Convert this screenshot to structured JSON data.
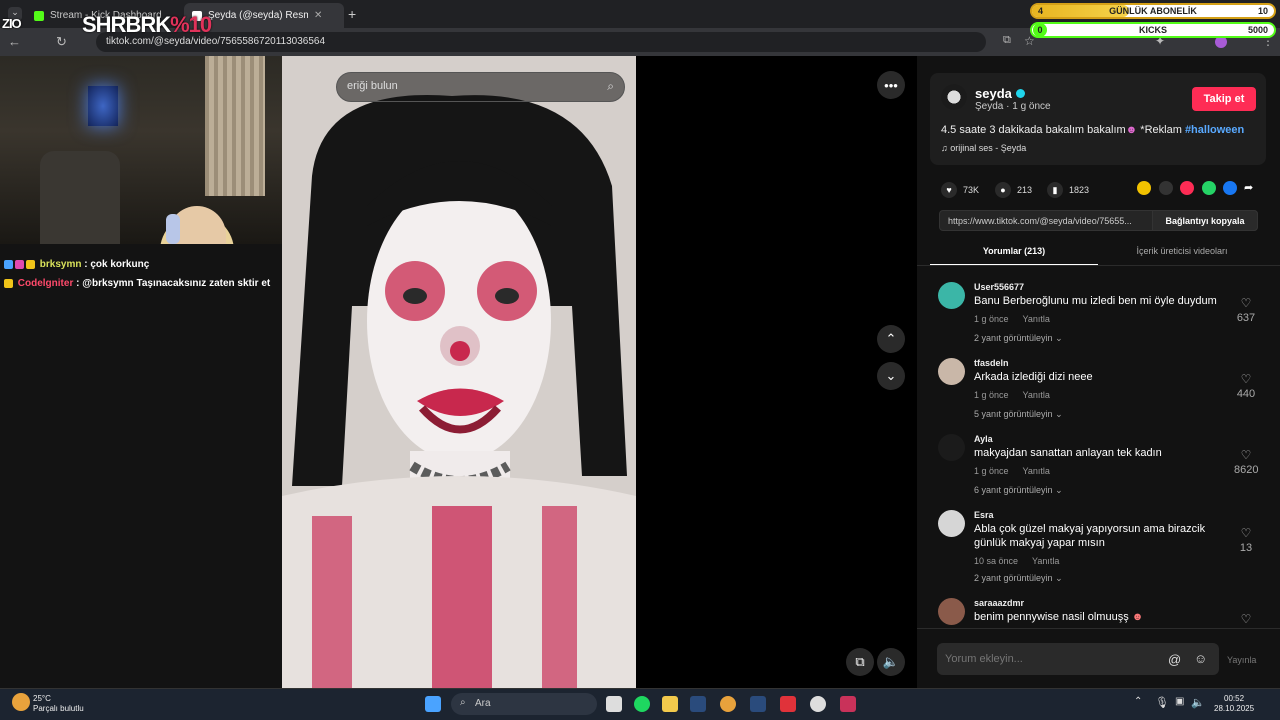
{
  "browser": {
    "tabs": [
      {
        "title": "Stream - Kick Dashboard",
        "active": false
      },
      {
        "title": "Şeyda (@seyda) Resmi | Tik",
        "active": true
      }
    ],
    "url": "tiktok.com/@seyda/video/7565586720113036564"
  },
  "overlay": {
    "logo_small": "ZIO",
    "logo_text": "SHRBRK",
    "logo_pct": "%10",
    "goals": [
      {
        "label": "GÜNLÜK ABONELİK",
        "current": "4",
        "target": "10",
        "progress": 0.4,
        "color": "#e7b520"
      },
      {
        "label": "KICKS",
        "current": "0",
        "target": "5000",
        "progress": 0.0,
        "color": "#53fc18"
      }
    ]
  },
  "chat": {
    "messages": [
      {
        "user": "brksymn",
        "text": "çok korkunç"
      },
      {
        "user": "Codelgniter",
        "text": "@brksymn Taşınacaksınız zaten sktir et"
      }
    ]
  },
  "video": {
    "search_placeholder": "eriği bulun"
  },
  "post": {
    "username": "seyda",
    "display_name": "Şeyda",
    "age": "1 g önce",
    "follow_label": "Takip et",
    "description": "4.5 saate 3 dakikada bakalım bakalım",
    "description_tail": " *Reklam ",
    "hashtag": "#halloween",
    "music": "orijinal ses - Şeyda",
    "likes": "73K",
    "comments": "213",
    "saves": "1823",
    "link": "https://www.tiktok.com/@seyda/video/75655...",
    "copy_label": "Bağlantıyı kopyala"
  },
  "tabs": {
    "comments": "Yorumlar (213)",
    "creator_videos": "İçerik üreticisi videoları"
  },
  "comments": [
    {
      "user": "User556677",
      "text": "Banu Berberoğlunu mu izledi ben mi öyle duydum",
      "age": "1 g önce",
      "reply": "Yanıtla",
      "more": "2 yanıt görüntüleyin",
      "likes": "637",
      "avatar": "#3bb6a7"
    },
    {
      "user": "tfasdeln",
      "text": "Arkada izlediği dizi neee",
      "age": "1 g önce",
      "reply": "Yanıtla",
      "more": "5 yanıt görüntüleyin",
      "likes": "440",
      "avatar": "#c9b7a8"
    },
    {
      "user": "Ayla",
      "text": "makyajdan sanattan anlayan tek kadın",
      "age": "1 g önce",
      "reply": "Yanıtla",
      "more": "6 yanıt görüntüleyin",
      "likes": "8620",
      "avatar": "#1b1b1b"
    },
    {
      "user": "Esra",
      "text": "Abla çok güzel makyaj yapıyorsun ama birazcik günlük makyaj yapar mısın",
      "age": "10 sa önce",
      "reply": "Yanıtla",
      "more": "2 yanıt görüntüleyin",
      "likes": "13",
      "avatar": "#d6d6d6"
    },
    {
      "user": "saraaazdmr",
      "text": "benim pennywise nasil olmuuşş",
      "age": "",
      "reply": "",
      "more": "",
      "likes": "",
      "avatar": "#8a5a4a"
    }
  ],
  "comment_input": {
    "placeholder": "Yorum ekleyin...",
    "post_label": "Yayınla"
  },
  "taskbar": {
    "temp": "25°C",
    "weather": "Parçalı bulutlu",
    "search": "Ara",
    "time": "00:52",
    "date": "28.10.2025"
  }
}
